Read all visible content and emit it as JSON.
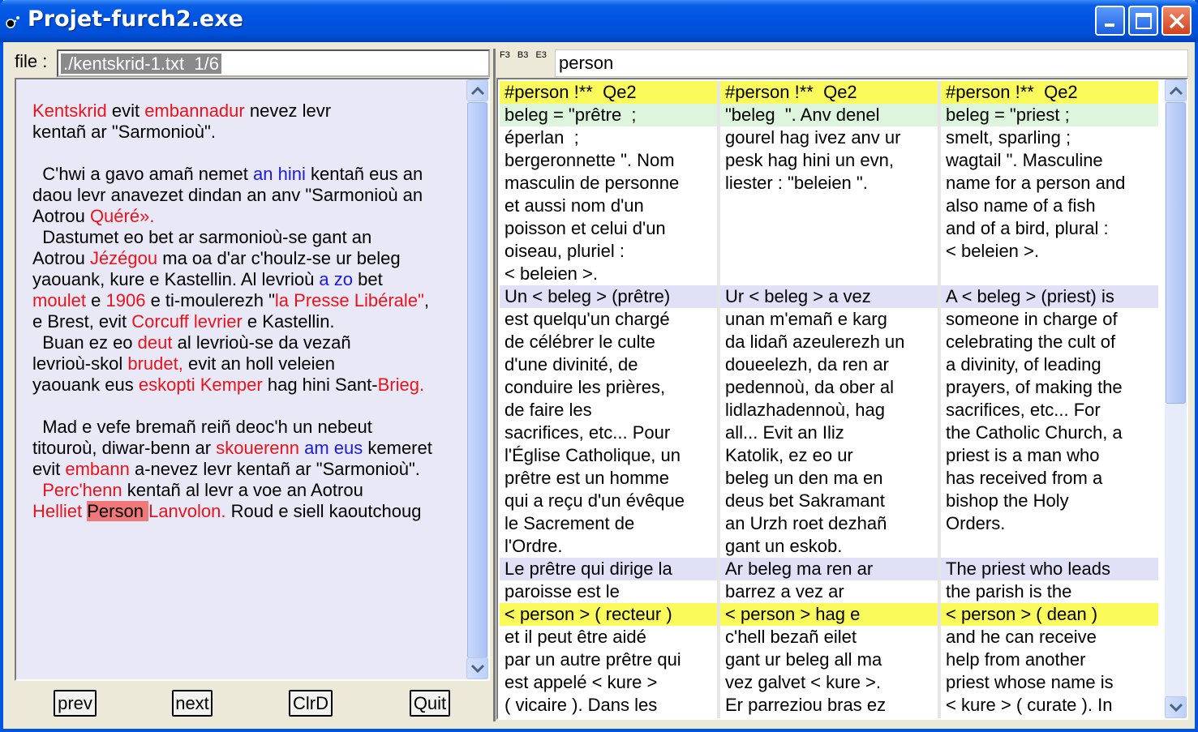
{
  "window": {
    "title": "Projet-furch2.exe"
  },
  "left": {
    "file_label": "file :",
    "file_value": "./kentskrid-1.txt  1/6",
    "lines": [
      [
        [
          "Kentskrid",
          "r"
        ],
        [
          " evit ",
          ""
        ],
        [
          "embannadur",
          "r"
        ],
        [
          " nevez levr",
          ""
        ]
      ],
      [
        [
          "kentañ ar \"Sarmonioù\".",
          ""
        ]
      ],
      [
        [
          "",
          ""
        ]
      ],
      [
        [
          "  C'hwi a gavo amañ nemet ",
          ""
        ],
        [
          "an hini",
          "b"
        ],
        [
          " kentañ eus an",
          ""
        ]
      ],
      [
        [
          "daou levr anavezet dindan an anv \"Sarmonioù an",
          ""
        ]
      ],
      [
        [
          "Aotrou ",
          ""
        ],
        [
          "Quéré».",
          "r"
        ]
      ],
      [
        [
          "  Dastumet eo bet ar sarmonioù-se gant an",
          ""
        ]
      ],
      [
        [
          "Aotrou ",
          ""
        ],
        [
          "Jézégou",
          "r"
        ],
        [
          " ma oa d'ar c'houlz-se ur beleg",
          ""
        ]
      ],
      [
        [
          "yaouank, kure e Kastellin. Al levrioù ",
          ""
        ],
        [
          "a zo",
          "b"
        ],
        [
          " bet",
          ""
        ]
      ],
      [
        [
          "moulet",
          "r"
        ],
        [
          " e ",
          ""
        ],
        [
          "1906",
          "r"
        ],
        [
          " e ti-moulerezh \"",
          ""
        ],
        [
          "la Presse Libérale\"",
          "r"
        ],
        [
          ",",
          ""
        ]
      ],
      [
        [
          "e Brest, evit ",
          ""
        ],
        [
          "Corcuff levrier",
          "r"
        ],
        [
          " e Kastellin.",
          ""
        ]
      ],
      [
        [
          "  Buan ez eo ",
          ""
        ],
        [
          "deut",
          "r"
        ],
        [
          " al levrioù-se da vezañ",
          ""
        ]
      ],
      [
        [
          "levrioù-skol ",
          ""
        ],
        [
          "brudet,",
          "r"
        ],
        [
          " evit an holl veleien",
          ""
        ]
      ],
      [
        [
          "yaouank eus ",
          ""
        ],
        [
          "eskopti Kemper",
          "r"
        ],
        [
          " hag hini Sant-",
          ""
        ],
        [
          "Brieg.",
          "r"
        ]
      ],
      [
        [
          "",
          ""
        ]
      ],
      [
        [
          "  Mad e vefe bremañ reiñ deoc'h un nebeut",
          ""
        ]
      ],
      [
        [
          "titouroù, diwar-benn ar ",
          ""
        ],
        [
          "skouerenn",
          "r"
        ],
        [
          " ",
          ""
        ],
        [
          "am eus",
          "b"
        ],
        [
          " kemeret",
          ""
        ]
      ],
      [
        [
          "evit ",
          ""
        ],
        [
          "embann",
          "r"
        ],
        [
          " a-nevez levr kentañ ar \"Sarmonioù\".",
          ""
        ]
      ],
      [
        [
          "  ",
          ""
        ],
        [
          "Perc'henn",
          "r"
        ],
        [
          " kentañ al levr a voe an Aotrou",
          ""
        ]
      ],
      [
        [
          "Helliet ",
          "r"
        ],
        [
          "Person ",
          "hl"
        ],
        [
          "Lanvolon.",
          "r"
        ],
        [
          " Roud e siell kaoutchoug",
          ""
        ]
      ]
    ],
    "buttons": {
      "prev": "prev",
      "next": "next",
      "clrd": "ClrD",
      "quit": "Quit"
    }
  },
  "right": {
    "flags": [
      "F3",
      "B3",
      "E3"
    ],
    "search_value": "person",
    "columns": [
      [
        [
          "y",
          "#person !**  Qe2"
        ],
        [
          "g",
          "beleg = \"prêtre  ;"
        ],
        [
          "w",
          "éperlan  ;"
        ],
        [
          "w",
          "bergeronnette \". Nom"
        ],
        [
          "w",
          "masculin de personne"
        ],
        [
          "w",
          "et aussi nom d'un"
        ],
        [
          "w",
          "poisson et celui d'un"
        ],
        [
          "w",
          "oiseau, pluriel :"
        ],
        [
          "w",
          "< beleien >."
        ],
        [
          "l",
          "Un < beleg > (prêtre)"
        ],
        [
          "w",
          "est quelqu'un chargé"
        ],
        [
          "w",
          "de célébrer le culte"
        ],
        [
          "w",
          "d'une divinité, de"
        ],
        [
          "w",
          "conduire les prières,"
        ],
        [
          "w",
          "de faire les"
        ],
        [
          "w",
          "sacrifices, etc... Pour"
        ],
        [
          "w",
          "l'Église Catholique, un"
        ],
        [
          "w",
          "prêtre est un homme"
        ],
        [
          "w",
          "qui a reçu d'un évêque"
        ],
        [
          "w",
          "le Sacrement de"
        ],
        [
          "w",
          "l'Ordre."
        ],
        [
          "l",
          "Le prêtre qui dirige la"
        ],
        [
          "w",
          "paroisse est le"
        ],
        [
          "y",
          "< person > ( recteur )"
        ],
        [
          "w",
          "et il peut être aidé"
        ],
        [
          "w",
          "par un autre prêtre qui"
        ],
        [
          "w",
          "est appelé < kure >"
        ],
        [
          "w",
          "( vicaire ). Dans les"
        ]
      ],
      [
        [
          "y",
          "#person !**  Qe2"
        ],
        [
          "g",
          "\"beleg  \". Anv denel"
        ],
        [
          "w",
          "gourel hag ivez anv ur"
        ],
        [
          "w",
          "pesk hag hini un evn,"
        ],
        [
          "w",
          "liester : \"beleien \"."
        ],
        [
          "w",
          ""
        ],
        [
          "w",
          ""
        ],
        [
          "w",
          ""
        ],
        [
          "w",
          ""
        ],
        [
          "l",
          "Ur < beleg > a vez"
        ],
        [
          "w",
          "unan m'emañ e karg"
        ],
        [
          "w",
          "da lidañ azeulerezh un"
        ],
        [
          "w",
          "doueelezh, da ren ar"
        ],
        [
          "w",
          "pedennoù, da ober al"
        ],
        [
          "w",
          "lidlazhadennoù, hag"
        ],
        [
          "w",
          "all... Evit an Iliz"
        ],
        [
          "w",
          "Katolik, ez eo ur"
        ],
        [
          "w",
          "beleg un den ma en"
        ],
        [
          "w",
          "deus bet Sakramant"
        ],
        [
          "w",
          "an Urzh roet dezhañ"
        ],
        [
          "w",
          "gant un eskob."
        ],
        [
          "l",
          "Ar beleg ma ren ar"
        ],
        [
          "w",
          "barrez a vez ar"
        ],
        [
          "y",
          "< person > hag e"
        ],
        [
          "w",
          "c'hell bezañ eilet"
        ],
        [
          "w",
          "gant ur beleg all ma"
        ],
        [
          "w",
          "vez galvet < kure >."
        ],
        [
          "w",
          "Er parreziou bras ez"
        ]
      ],
      [
        [
          "y",
          "#person !**  Qe2"
        ],
        [
          "g",
          "beleg = \"priest ;"
        ],
        [
          "w",
          "smelt, sparling ;"
        ],
        [
          "w",
          "wagtail \". Masculine"
        ],
        [
          "w",
          "name for a person and"
        ],
        [
          "w",
          "also name of a fish"
        ],
        [
          "w",
          "and of a bird, plural :"
        ],
        [
          "w",
          "< beleien >."
        ],
        [
          "w",
          ""
        ],
        [
          "l",
          "A < beleg > (priest) is"
        ],
        [
          "w",
          "someone in charge of"
        ],
        [
          "w",
          "celebrating the cult of"
        ],
        [
          "w",
          "a divinity, of leading"
        ],
        [
          "w",
          "prayers, of making the"
        ],
        [
          "w",
          "sacrifices, etc... For"
        ],
        [
          "w",
          "the Catholic Church, a"
        ],
        [
          "w",
          "priest is a man who"
        ],
        [
          "w",
          "has received from a"
        ],
        [
          "w",
          "bishop the Holy"
        ],
        [
          "w",
          "Orders."
        ],
        [
          "w",
          ""
        ],
        [
          "l",
          "The priest who leads"
        ],
        [
          "w",
          "the parish is the"
        ],
        [
          "y",
          "< person > ( dean )"
        ],
        [
          "w",
          "and he can receive"
        ],
        [
          "w",
          "help from another"
        ],
        [
          "w",
          "priest whose name is"
        ],
        [
          "w",
          "< kure > ( curate ). In"
        ]
      ]
    ]
  },
  "icons": {
    "app": "app-icon",
    "minimize": "minimize-icon",
    "maximize": "maximize-icon",
    "close": "close-icon",
    "scroll_up": "chevron-up-icon",
    "scroll_down": "chevron-down-icon"
  }
}
